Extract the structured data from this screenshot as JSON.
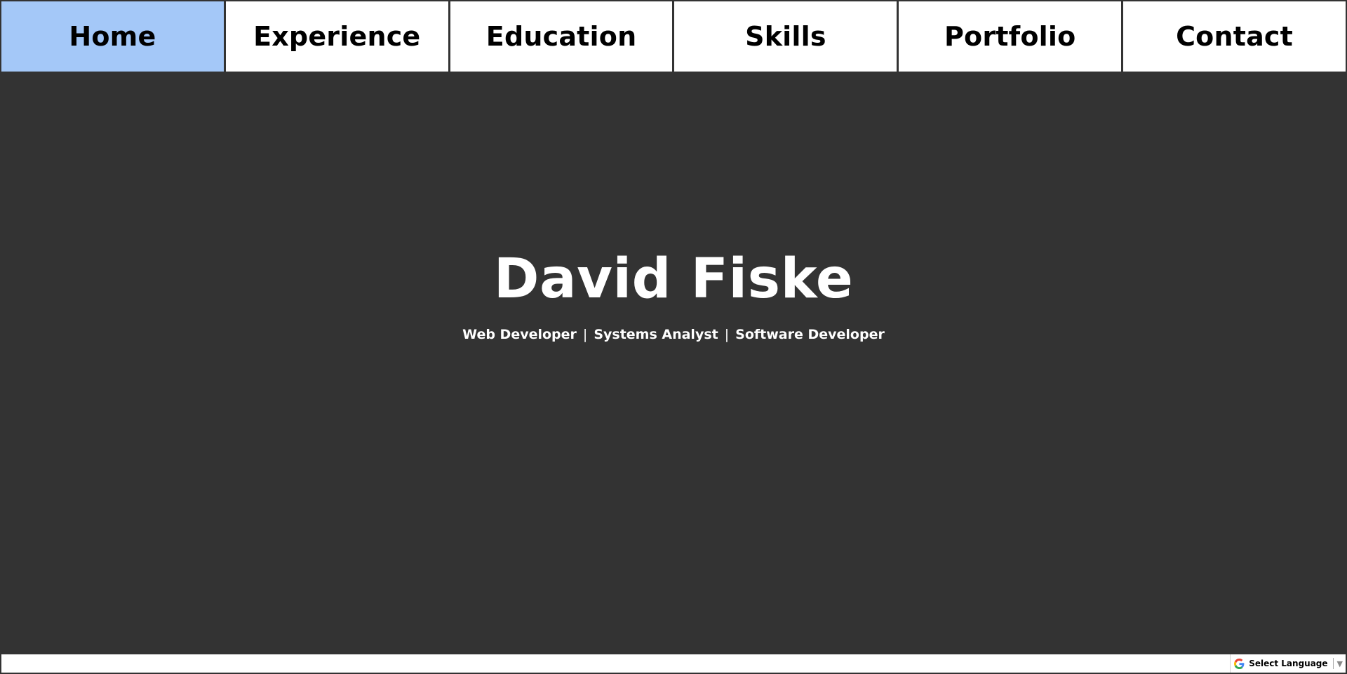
{
  "nav": {
    "items": [
      {
        "label": "Home",
        "active": true
      },
      {
        "label": "Experience",
        "active": false
      },
      {
        "label": "Education",
        "active": false
      },
      {
        "label": "Skills",
        "active": false
      },
      {
        "label": "Portfolio",
        "active": false
      },
      {
        "label": "Contact",
        "active": false
      }
    ]
  },
  "hero": {
    "name": "David Fiske",
    "roles": [
      "Web Developer",
      "Systems Analyst",
      "Software Developer"
    ],
    "separator": "|"
  },
  "translate": {
    "label": "Select Language",
    "icon": "google-g-icon",
    "arrow": "▼"
  },
  "colors": {
    "background": "#333333",
    "nav_active": "#a4c8f8",
    "nav_default": "#ffffff",
    "text_light": "#ffffff",
    "text_dark": "#000000"
  }
}
